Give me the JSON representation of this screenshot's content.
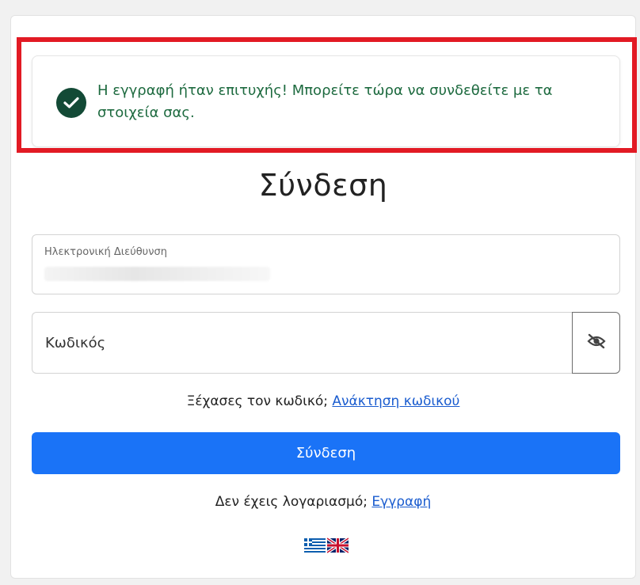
{
  "alert": {
    "message": "Η εγγραφή ήταν επιτυχής! Μπορείτε τώρα να συνδεθείτε με τα στοιχεία σας.",
    "icon": "check-circle-icon",
    "icon_color": "#134a36",
    "text_color": "#1d6a3f",
    "highlight_color": "#e21a24"
  },
  "login": {
    "title": "Σύνδεση",
    "email_label": "Ηλεκτρονική Διεύθυνση",
    "email_value": "",
    "password_placeholder": "Κωδικός",
    "password_toggle_icon": "eye-slash-icon",
    "forgot_text": "Ξέχασες τον κωδικό;",
    "forgot_link": "Ανάκτηση κωδικού",
    "submit_label": "Σύνδεση",
    "submit_color": "#1a73f7",
    "register_text": "Δεν έχεις λογαριασμό;",
    "register_link": "Εγγραφή"
  },
  "languages": [
    {
      "code": "el",
      "icon": "greek-flag-icon"
    },
    {
      "code": "en",
      "icon": "uk-flag-icon"
    }
  ]
}
